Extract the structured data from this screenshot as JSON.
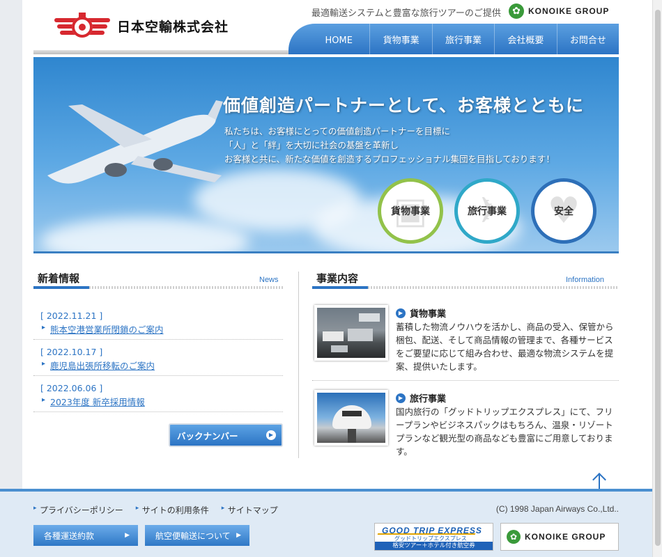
{
  "header": {
    "company_name": "日本空輸株式会社",
    "tagline": "最適輸送システムと豊富な旅行ツアーのご提供",
    "group_logo": "KONOIKE GROUP"
  },
  "nav": {
    "items": [
      "HOME",
      "貨物事業",
      "旅行事業",
      "会社概要",
      "お問合せ"
    ]
  },
  "hero": {
    "headline": "価値創造パートナーとして、お客様とともに",
    "lead_lines": [
      "私たちは、お客様にとっての価値創造パートナーを目標に",
      "「人」と「絆」を大切に社会の基盤を革新し",
      "お客様と共に、新たな価値を創造するプロフェッショナル集団を目指しております！"
    ],
    "buttons": [
      {
        "label": "貨物事業",
        "color": "#92c24a"
      },
      {
        "label": "旅行事業",
        "color": "#2fa8c8"
      },
      {
        "label": "安全",
        "color": "#2d6fb8"
      }
    ]
  },
  "news": {
    "title": "新着情報",
    "title_en": "News",
    "items": [
      {
        "date": "[ 2022.11.21 ]",
        "text": "熊本空港営業所閉鎖のご案内"
      },
      {
        "date": "[ 2022.10.17 ]",
        "text": "鹿児島出張所移転のご案内"
      },
      {
        "date": "[ 2022.06.06 ]",
        "text": "2023年度 新卒採用情報"
      }
    ],
    "backnumber_label": "バックナンバー"
  },
  "business": {
    "title": "事業内容",
    "title_en": "Information",
    "items": [
      {
        "title": "貨物事業",
        "text": "蓄積した物流ノウハウを活かし、商品の受入、保管から梱包、配送、そして商品情報の管理まで、各種サービスをご要望に応じて組み合わせ、最適な物流システムを提案、提供いたします。"
      },
      {
        "title": "旅行事業",
        "text": "国内旅行の「グッドトリップエクスプレス」にて、フリープランやビジネスパックはもちろん、温泉・リゾートプランなど観光型の商品なども豊富にご用意しております。"
      }
    ]
  },
  "footer": {
    "links": [
      "プライバシーポリシー",
      "サイトの利用条件",
      "サイトマップ"
    ],
    "copyright": "(C) 1998 Japan Airways Co.,Ltd..",
    "buttons": [
      "各種運送約款",
      "航空便輸送について"
    ],
    "banner_gte": {
      "title": "GOOD TRIP EXPRESS",
      "kana": "グッドトリップエクスプレス",
      "sub": "格安ツアー＋ホテル付き航空券"
    },
    "banner_konoike": "KONOIKE GROUP"
  },
  "colors": {
    "accent_blue": "#2c74c4",
    "brand_red": "#d7282f",
    "konoike_green": "#3a9a3a"
  }
}
